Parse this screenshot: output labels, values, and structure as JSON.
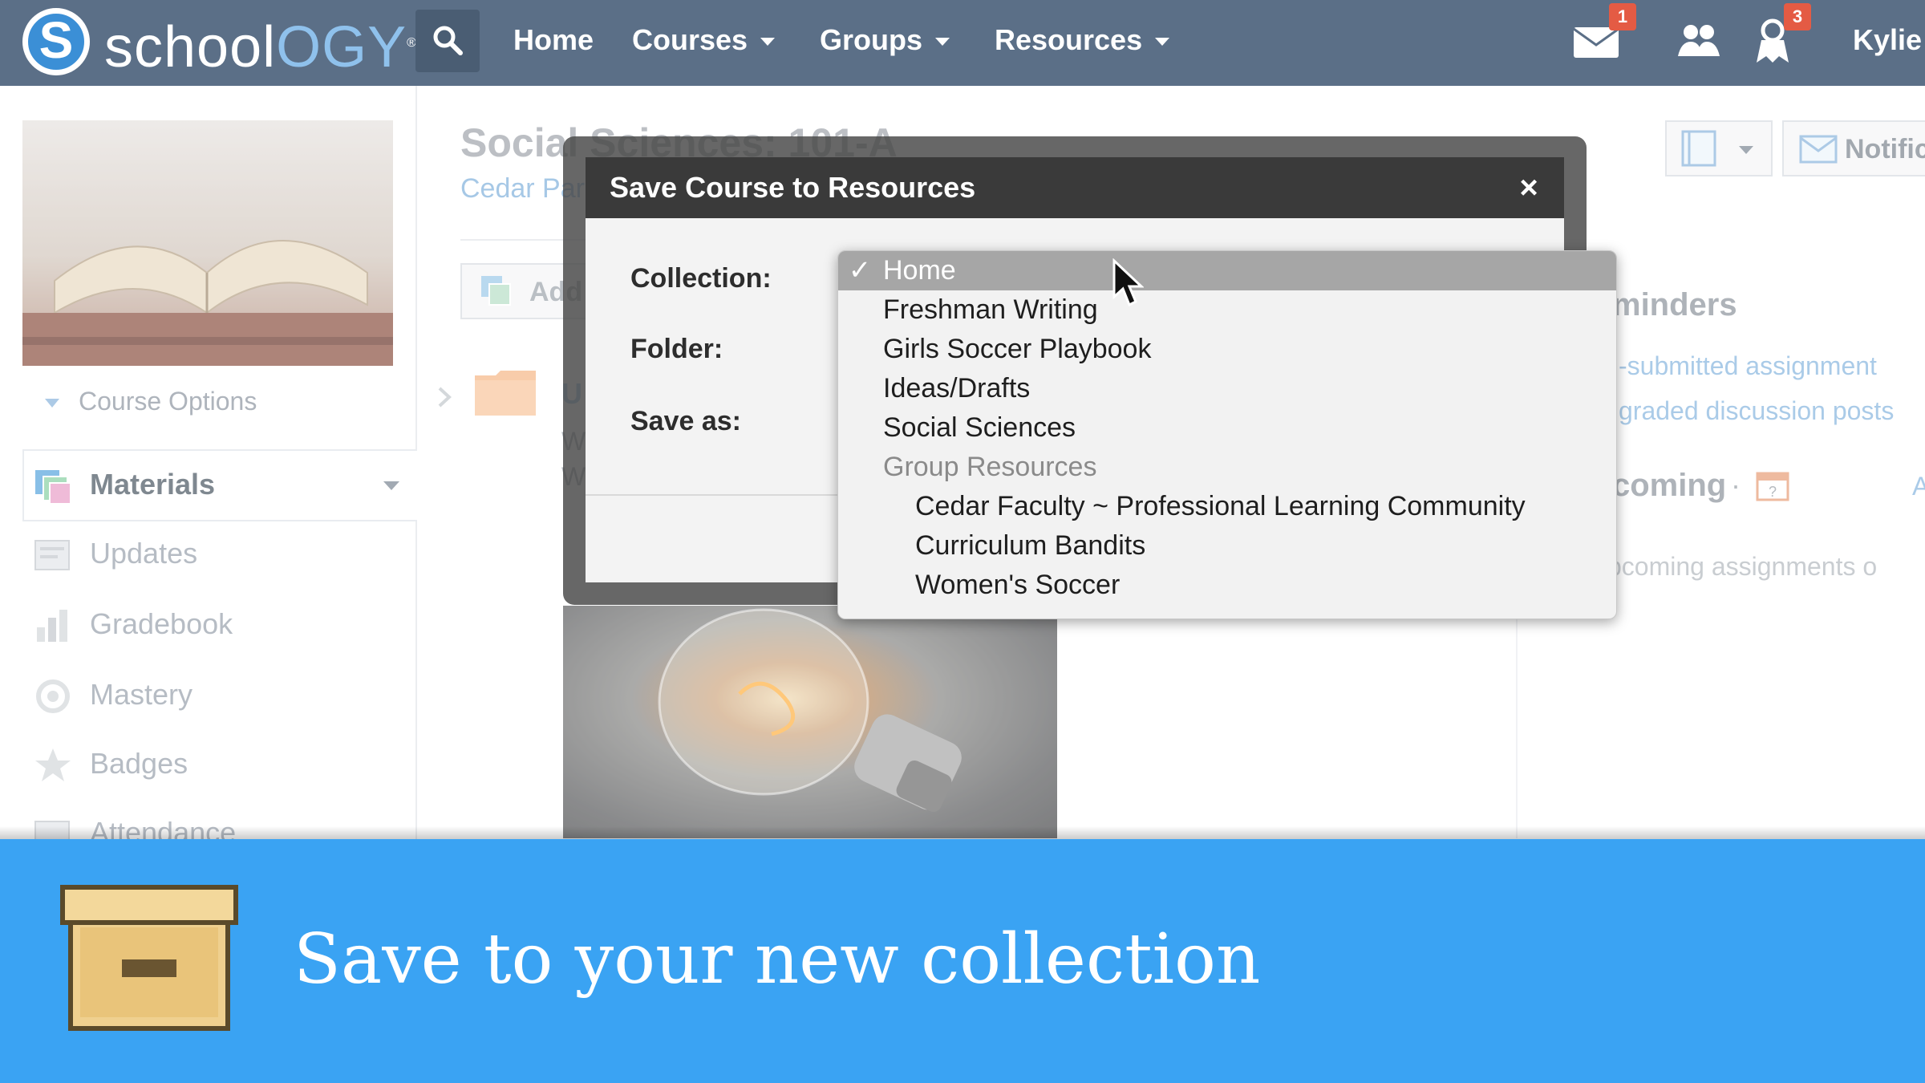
{
  "brand": {
    "logo_letter": "S",
    "name_part1": "school",
    "name_part2": "OGY",
    "trademark": "®"
  },
  "topnav": {
    "items": [
      {
        "label": "Home",
        "has_menu": false
      },
      {
        "label": "Courses",
        "has_menu": true
      },
      {
        "label": "Groups",
        "has_menu": true
      },
      {
        "label": "Resources",
        "has_menu": true
      }
    ],
    "messages_badge": "1",
    "notifications_badge": "3",
    "user_name": "Kylie"
  },
  "sidebar": {
    "course_options": "Course Options",
    "items": [
      {
        "label": "Materials",
        "icon": "materials-icon"
      },
      {
        "label": "Updates",
        "icon": "updates-icon"
      },
      {
        "label": "Gradebook",
        "icon": "gradebook-icon"
      },
      {
        "label": "Mastery",
        "icon": "mastery-icon"
      },
      {
        "label": "Badges",
        "icon": "badge-star-icon"
      },
      {
        "label": "Attendance",
        "icon": "attendance-icon"
      }
    ]
  },
  "course": {
    "title": "Social Sciences: 101-A",
    "subtitle": "Cedar Par",
    "add_button": "Add",
    "folder_initial": "U",
    "folder_line1": "W",
    "folder_line2": "W"
  },
  "right_panel": {
    "notif_button": "Notific",
    "reminders_title": "minders",
    "reminders": [
      "-submitted assignment",
      "graded discussion posts"
    ],
    "upcoming_title": "coming",
    "upcoming_dot": "·",
    "upcoming_letter": "A",
    "upcoming_empty": "pcoming assignments o"
  },
  "modal": {
    "title": "Save Course to Resources",
    "close": "×",
    "labels": {
      "collection": "Collection:",
      "folder": "Folder:",
      "save_as": "Save as:"
    }
  },
  "dropdown": {
    "check": "✓",
    "options": [
      {
        "label": "Home",
        "selected": true,
        "type": "option"
      },
      {
        "label": "Freshman Writing",
        "selected": false,
        "type": "option"
      },
      {
        "label": "Girls Soccer Playbook",
        "selected": false,
        "type": "option"
      },
      {
        "label": "Ideas/Drafts",
        "selected": false,
        "type": "option"
      },
      {
        "label": "Social Sciences",
        "selected": false,
        "type": "option"
      },
      {
        "label": "Group Resources",
        "selected": false,
        "type": "group"
      },
      {
        "label": "Cedar Faculty ~ Professional Learning Community",
        "selected": false,
        "type": "indent"
      },
      {
        "label": "Curriculum Bandits",
        "selected": false,
        "type": "indent"
      },
      {
        "label": "Women's Soccer",
        "selected": false,
        "type": "indent"
      }
    ]
  },
  "banner": {
    "text": "Save to your new collection",
    "icon": "archive-box-icon"
  },
  "colors": {
    "topbar": "#5b6f87",
    "banner": "#3aa3f3",
    "modal_header": "#3a3a3a",
    "badge": "#e45b44"
  }
}
